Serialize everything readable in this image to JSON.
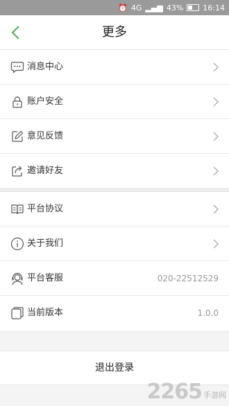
{
  "status_bar": {
    "network": "4G",
    "battery": "43%",
    "time": "16:14"
  },
  "nav": {
    "title": "更多",
    "back_icon": "chevron-left-icon"
  },
  "menu_group_1": [
    {
      "label": "消息中心",
      "icon": "message-bubble-icon"
    },
    {
      "label": "账户安全",
      "icon": "lock-icon"
    },
    {
      "label": "意见反馈",
      "icon": "edit-icon"
    },
    {
      "label": "邀请好友",
      "icon": "share-icon"
    }
  ],
  "menu_group_2": [
    {
      "label": "平台协议",
      "icon": "book-icon"
    },
    {
      "label": "关于我们",
      "icon": "info-icon"
    },
    {
      "label": "平台客服",
      "icon": "headset-icon",
      "value": "020-22512529"
    },
    {
      "label": "当前版本",
      "icon": "version-icon",
      "value": "1.0.0"
    }
  ],
  "logout": {
    "label": "退出登录"
  },
  "watermark": {
    "number": "2265",
    "text": "手游网"
  },
  "colors": {
    "accent": "#4caf50",
    "background": "#f4f4f4"
  }
}
